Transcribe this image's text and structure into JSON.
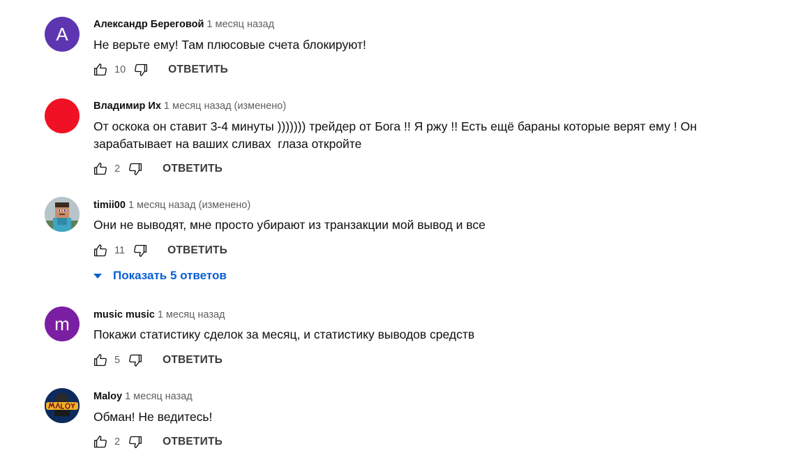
{
  "comments": [
    {
      "author": "Александр Береговой",
      "time": "1 месяц назад",
      "text": "Не верьте ему! Там плюсовые счета блокируют!",
      "likes": "10",
      "reply_label": "ОТВЕТИТЬ",
      "avatar": {
        "letter": "A",
        "color": "#5e35b1"
      }
    },
    {
      "author": "Владимир Их",
      "time": "1 месяц назад (изменено)",
      "text": "От оскока он ставит 3-4 минуты ))))))) трейдер от Бога !! Я ржу !! Есть ещё бараны которые верят ему ! Он зарабатывает на ваших сливах  глаза откройте",
      "likes": "2",
      "reply_label": "ОТВЕТИТЬ",
      "avatar": {
        "color": "#f11124"
      }
    },
    {
      "author": "timii00",
      "time": "1 месяц назад (изменено)",
      "text": "Они не выводят, мне просто убирают из транзакции мой вывод и все",
      "likes": "11",
      "reply_label": "ОТВЕТИТЬ",
      "avatar": {
        "icon": "minecraft-character-avatar"
      }
    },
    {
      "author": "music music",
      "time": "1 месяц назад",
      "text": "Покажи статистику сделок за месяц, и статистику выводов средств",
      "likes": "5",
      "reply_label": "ОТВЕТИТЬ",
      "avatar": {
        "letter": "m",
        "color": "#7b1fa2"
      }
    },
    {
      "author": "Maloy",
      "time": "1 месяц назад",
      "text": "Обман! Не ведитесь!",
      "likes": "2",
      "reply_label": "ОТВЕТИТЬ",
      "avatar": {
        "icon": "maloy-logo-avatar"
      }
    }
  ],
  "show_replies": {
    "label": "Показать 5 ответов",
    "color": "#065fd4"
  }
}
